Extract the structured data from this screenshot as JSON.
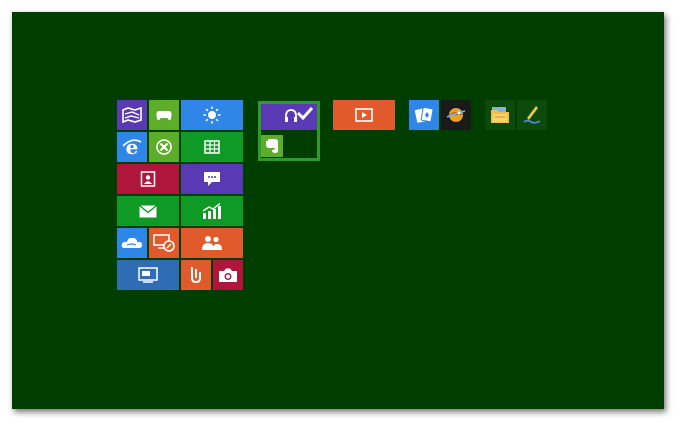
{
  "desktop": {
    "background": "#003E00"
  },
  "tiles": {
    "maps": {
      "icon": "map-icon",
      "color": "#5A3AB4"
    },
    "games": {
      "icon": "game-controller-icon",
      "color": "#5BAD2A"
    },
    "weather": {
      "icon": "sun-icon",
      "color": "#2F86E6"
    },
    "ie": {
      "icon": "internet-explorer-icon",
      "color": "#2F86E6"
    },
    "xbox": {
      "icon": "xbox-icon",
      "color": "#5BAD2A"
    },
    "finance": {
      "icon": "spreadsheet-icon",
      "color": "#0E9A25"
    },
    "contacts": {
      "icon": "contact-card-icon",
      "color": "#B0163C"
    },
    "messaging": {
      "icon": "chat-bubble-icon",
      "color": "#5A3AB4"
    },
    "mail": {
      "icon": "envelope-icon",
      "color": "#0E9A25"
    },
    "stocks": {
      "icon": "chart-icon",
      "color": "#0E9A25"
    },
    "skydrive": {
      "icon": "cloud-icon",
      "color": "#2F86E6"
    },
    "remote": {
      "icon": "remote-desktop-icon",
      "color": "#E05A2C"
    },
    "people": {
      "icon": "people-icon",
      "color": "#E05A2C"
    },
    "desktop": {
      "icon": "desktop-icon",
      "color": "#2E6DB4"
    },
    "reader": {
      "icon": "reader-icon",
      "color": "#E05A2C"
    },
    "camera": {
      "icon": "camera-icon",
      "color": "#B0163C"
    },
    "music": {
      "icon": "headphones-icon",
      "color": "#5A3AB4"
    },
    "evernote": {
      "icon": "evernote-icon",
      "color": "#5BAD2A"
    },
    "video": {
      "icon": "play-icon",
      "color": "#E05A2C"
    },
    "solitaire": {
      "icon": "cards-icon",
      "color": "#2F86E6"
    },
    "app-dark": {
      "icon": "orb-icon",
      "color": "#1A1A1A"
    },
    "explorer": {
      "icon": "folder-icon",
      "color": "#0B4A0B"
    },
    "writer": {
      "icon": "pen-icon",
      "color": "#0B4A0B"
    }
  }
}
